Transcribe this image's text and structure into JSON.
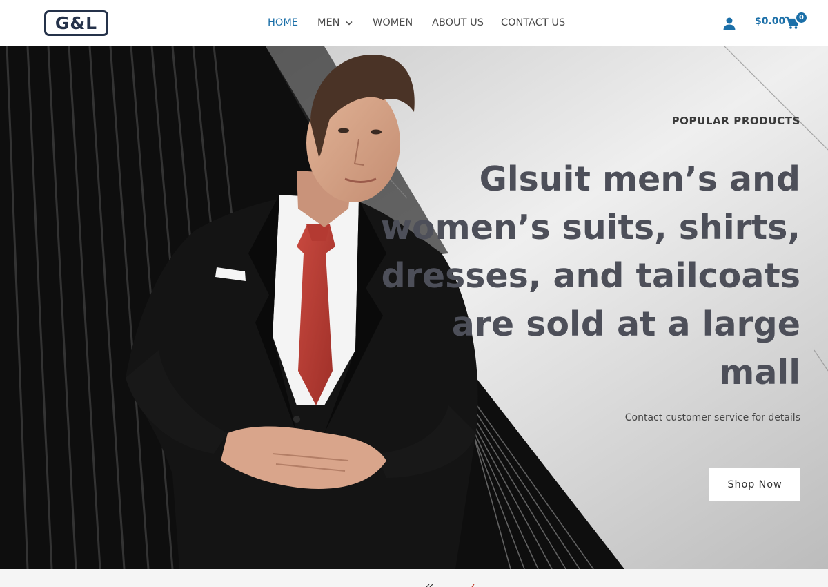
{
  "brand": {
    "logo_text": "G&L",
    "accent": "#1b6fa8",
    "dark": "#25324a"
  },
  "nav": {
    "items": [
      {
        "label": "HOME",
        "active": true
      },
      {
        "label": "MEN",
        "active": false,
        "has_dropdown": true
      },
      {
        "label": "WOMEN",
        "active": false
      },
      {
        "label": "ABOUT US",
        "active": false
      },
      {
        "label": "CONTACT US",
        "active": false
      }
    ]
  },
  "header_actions": {
    "account_icon": "user-icon",
    "cart_total": "$0.00",
    "cart_icon": "cart-icon",
    "cart_count": "0"
  },
  "hero": {
    "eyebrow": "POPULAR PRODUCTS",
    "title": "Glsuit men’s and women’s suits, shirts, dresses, and tailcoats are sold at a large mall",
    "subtitle": "Contact customer service for details",
    "cta_label": "Shop Now",
    "image": "man-in-black-suit-with-red-tie"
  }
}
